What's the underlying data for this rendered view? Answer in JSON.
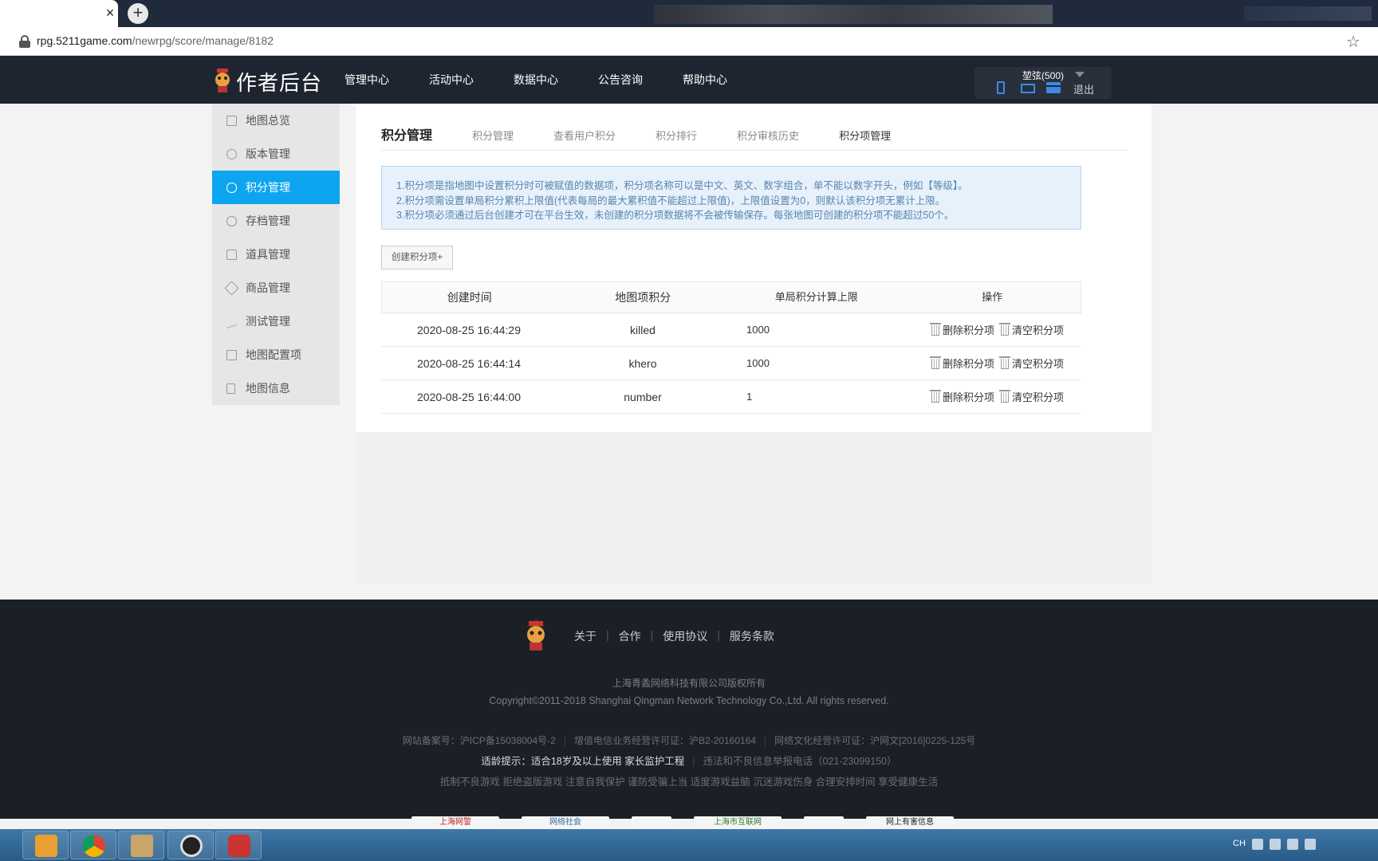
{
  "browser": {
    "close_tab": "×",
    "new_tab": "+",
    "url_host": "rpg.5211game.com",
    "url_path": "/newrpg/score/manage/8182",
    "star": "☆"
  },
  "header": {
    "logo_text": "作者后台",
    "nav": [
      "管理中心",
      "活动中心",
      "数据中心",
      "公告咨询",
      "帮助中心"
    ],
    "user_name": "堃弦(500)",
    "logout": "退出"
  },
  "sidebar": {
    "items": [
      {
        "label": "地图总览",
        "icon": "grid-icon"
      },
      {
        "label": "版本管理",
        "icon": "cloud-upload-icon"
      },
      {
        "label": "积分管理",
        "icon": "database-icon",
        "active": true
      },
      {
        "label": "存档管理",
        "icon": "database-icon"
      },
      {
        "label": "道具管理",
        "icon": "bag-icon"
      },
      {
        "label": "商品管理",
        "icon": "box-icon"
      },
      {
        "label": "测试管理",
        "icon": "trend-icon"
      },
      {
        "label": "地图配置项",
        "icon": "config-icon"
      },
      {
        "label": "地图信息",
        "icon": "document-icon"
      }
    ]
  },
  "main": {
    "title": "积分管理",
    "tabs": [
      "积分管理",
      "查看用户积分",
      "积分排行",
      "积分审核历史",
      "积分项管理"
    ],
    "current_tab": 4,
    "notice": [
      "1.积分项是指地图中设置积分时可被赋值的数据项，积分项名称可以是中文、英文、数字组合，单不能以数字开头，例如【等级】。",
      "2.积分项需设置单局积分累积上限值(代表每局的最大累积值不能超过上限值)，上限值设置为0，则默认该积分项无累计上限。",
      "3.积分项必须通过后台创建才可在平台生效，未创建的积分项数据将不会被传输保存。每张地图可创建的积分项不能超过50个。"
    ],
    "create_button": "创建积分项+",
    "table": {
      "headers": [
        "创建时间",
        "地图项积分",
        "单局积分计算上限",
        "操作"
      ],
      "rows": [
        {
          "time": "2020-08-25 16:44:29",
          "name": "killed",
          "limit": "1000"
        },
        {
          "time": "2020-08-25 16:44:14",
          "name": "khero",
          "limit": "1000"
        },
        {
          "time": "2020-08-25 16:44:00",
          "name": "number",
          "limit": "1"
        }
      ],
      "delete_label": "删除积分项",
      "clear_label": "清空积分项"
    }
  },
  "footer": {
    "links": [
      "关于",
      "合作",
      "使用协议",
      "服务条款"
    ],
    "company": "上海青螽网络科技有限公司版权所有",
    "copyright": "Copyright©2011-2018 Shanghai Qingman Network Technology Co.,Ltd. All rights reserved.",
    "licenses": [
      "网站备案号：沪ICP备15038004号-2",
      "增值电信业务经营许可证：沪B2-20160164",
      "网络文化经营许可证：沪网文[2016]0225-125号"
    ],
    "age_tip_strong": "适龄提示：适合18岁及以上使用 家长监护工程",
    "report_phone": "违法和不良信息举报电话（021-23099150）",
    "health": "抵制不良游戏 拒绝盗版游戏 注意自我保护 谨防受骗上当 适度游戏益脑 沉迷游戏伤身 合理安排时间 享受健康生活",
    "badges": [
      "上海网警",
      "网络社会",
      "",
      "上海市互联网",
      "",
      "网上有害信息"
    ]
  },
  "taskbar": {
    "tray_lang": "CH"
  },
  "colors": {
    "accent": "#0ea5f0",
    "header_bg": "#1f2530",
    "notice_bg": "#e6f1fb"
  }
}
